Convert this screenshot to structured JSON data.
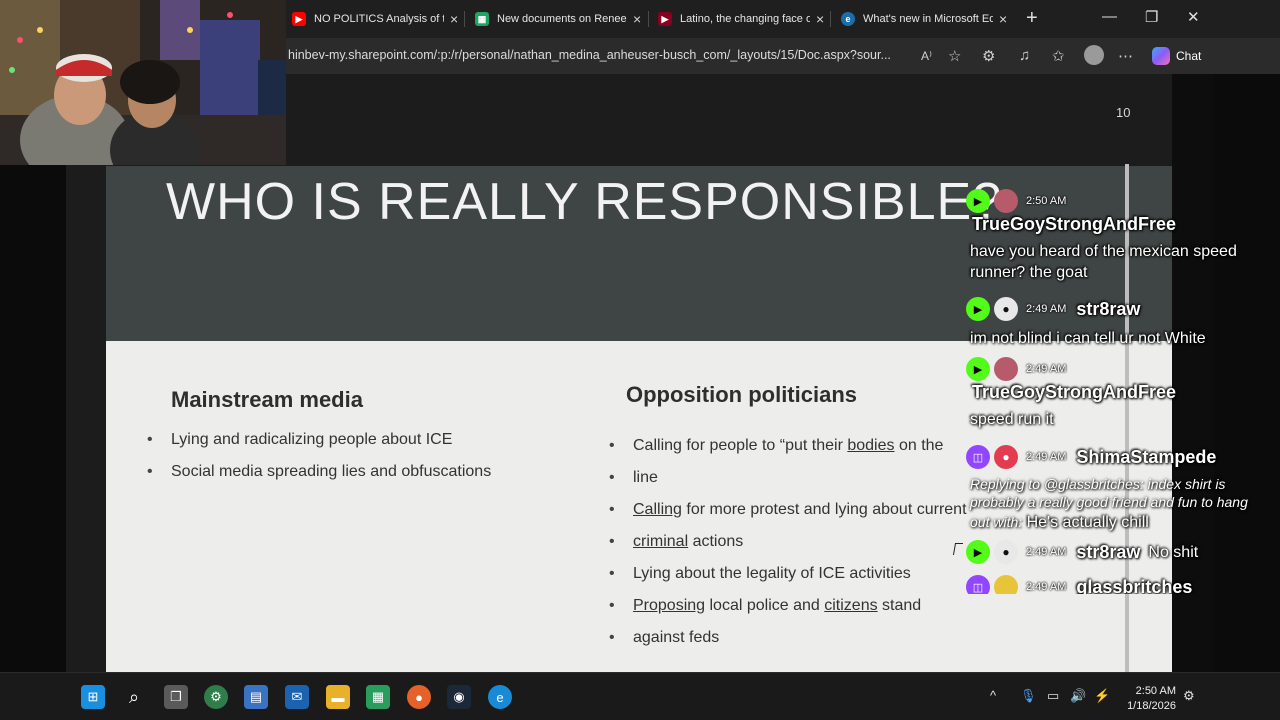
{
  "browser": {
    "tabs": [
      {
        "title": "NO POLITICS Analysis of th",
        "favicon": "youtube-icon",
        "color": "#ff0000"
      },
      {
        "title": "New documents on Renee",
        "favicon": "sheets-icon",
        "color": "#1fa463"
      },
      {
        "title": "Latino, the changing face o",
        "favicon": "youtube-icon",
        "color": "#c4002b"
      },
      {
        "title": "What's new in Microsoft Ed",
        "favicon": "edge-icon",
        "color": "#2a8fd6"
      }
    ],
    "url": "hinbev-my.sharepoint.com/:p:/r/personal/nathan_medina_anheuser-busch_com/_layouts/15/Doc.aspx?sour...",
    "chat_label": "Chat"
  },
  "document": {
    "page_number": "10",
    "slide_title": "WHO IS REALLY RESPONSIBLE?",
    "left_column": {
      "heading": "Mainstream media",
      "bullets": [
        "Lying and radicalizing people about ICE",
        "Social media spreading lies and obfuscations"
      ]
    },
    "right_column": {
      "heading": "Opposition politicians",
      "bullets": {
        "b1_a": "Calling for people to “put their ",
        "b1_u": "bodies",
        "b1_b": " on the",
        "b1_c": "line",
        "b2_u": "Calling",
        "b2_a": " for more protest and lying about current",
        "b2_u2": "criminal",
        "b2_b": " actions",
        "b3": "Lying about the legality of ICE activities",
        "b4_u": "Proposing",
        "b4_a": " local police and ",
        "b4_u2": "citizens",
        "b4_b": " stand",
        "b4_c": "against feds"
      }
    }
  },
  "chat": {
    "messages": [
      {
        "platform": "kick",
        "time": "2:50 AM",
        "user": "TrueGoyStrongAndFree",
        "text": "have you heard of the mexican speed runner? the goat"
      },
      {
        "platform": "kick",
        "time": "2:49 AM",
        "user": "str8raw",
        "text": "im not blind i can tell ur not White"
      },
      {
        "platform": "kick",
        "time": "2:49 AM",
        "user": "TrueGoyStrongAndFree",
        "text": "speed run it"
      },
      {
        "platform": "twitch",
        "time": "2:49 AM",
        "user": "ShimaStampede",
        "reply": "Replying to @glassbritches: index shirt is probably a really good friend and fun to hang out with:",
        "text": "He's actually chill"
      },
      {
        "platform": "kick",
        "time": "2:49 AM",
        "user": "str8raw",
        "text": "No shit"
      },
      {
        "platform": "twitch",
        "time": "2:49 AM",
        "user": "glassbritches",
        "text": ""
      }
    ]
  },
  "taskbar": {
    "time": "2:50 AM",
    "date": "1/18/2026"
  }
}
